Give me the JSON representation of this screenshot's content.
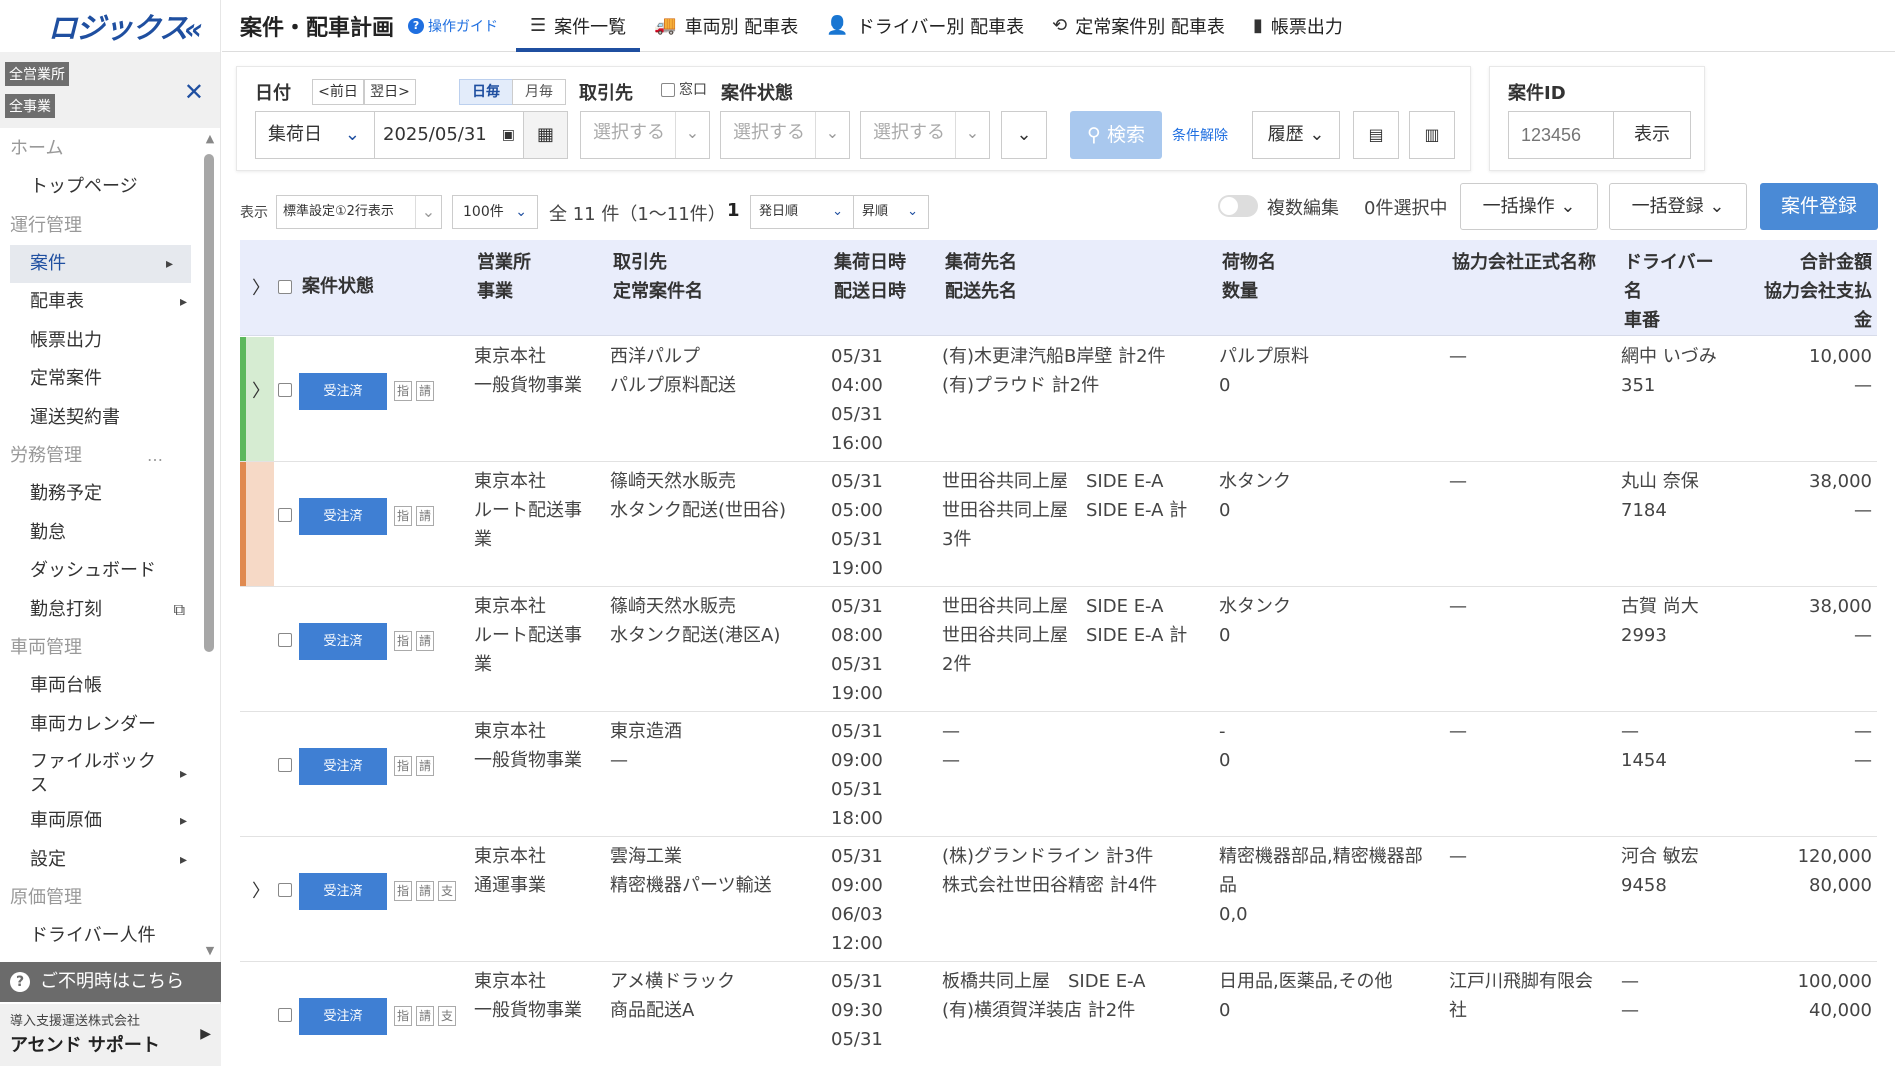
{
  "brand": {
    "logo": "ロジックス"
  },
  "scope": {
    "tag1": "全営業所",
    "tag2": "全事業"
  },
  "nav": {
    "home": "ホーム",
    "top_page": "トップページ",
    "ops": "運行管理",
    "cases": "案件",
    "dispatch": "配車表",
    "forms": "帳票出力",
    "regular": "定常案件",
    "contracts": "運送契約書",
    "labor": "労務管理",
    "labor_more": "…",
    "shift": "勤務予定",
    "attendance": "勤怠",
    "dashboard": "ダッシュボード",
    "clock": "勤怠打刻",
    "vehicle": "車両管理",
    "ledger": "車両台帳",
    "calendar": "車両カレンダー",
    "filebox": "ファイルボックス",
    "vcost": "車両原価",
    "settings": "設定",
    "cost": "原価管理",
    "driver_cost": "ドライバー人件"
  },
  "help": {
    "label": "ご不明時はこちら"
  },
  "company": {
    "sub": "導入支援運送株式会社",
    "name": "アセンド サポート"
  },
  "header": {
    "title": "案件・配車計画",
    "guide": "操作ガイド",
    "tabs": [
      "案件一覧",
      "車両別 配車表",
      "ドライバー別 配車表",
      "定常案件別 配車表",
      "帳票出力"
    ]
  },
  "filter": {
    "date_label": "日付",
    "prev": "<前日",
    "next": "翌日>",
    "daily": "日毎",
    "monthly": "月毎",
    "client_label": "取引先",
    "window_label": "窓口",
    "status_label": "案件状態",
    "date_type": "集荷日",
    "date_value": "2025/05/31",
    "select_ph": "選択する",
    "search": "検索",
    "clear": "条件解除",
    "history": "履歴"
  },
  "idsearch": {
    "label": "案件ID",
    "placeholder": "123456",
    "show": "表示"
  },
  "toolbar": {
    "display_label": "表示",
    "display_value": "標準設定①2行表示",
    "per_page": "100件",
    "count": "全 11 件（1〜11件）",
    "page": "1",
    "sort_field": "発日順",
    "sort_dir": "昇順",
    "multi_edit": "複数編集",
    "selected": "0件選択中",
    "bulk_ops": "一括操作",
    "bulk_reg": "一括登録",
    "new_case": "案件登録"
  },
  "columns": {
    "status": "案件状態",
    "office": "営業所",
    "business": "事業",
    "client": "取引先",
    "regular_name": "定常案件名",
    "pickup_dt": "集荷日時",
    "delivery_dt": "配送日時",
    "pickup_to": "集荷先名",
    "delivery_to": "配送先名",
    "cargo": "荷物名",
    "qty": "数量",
    "partner": "協力会社正式名称",
    "driver_l1": "ドライバー",
    "driver_l2": "名",
    "car_no": "車番",
    "total_l1": "合計金額",
    "total_l2": "協力会社支払",
    "total_l3": "金"
  },
  "rows": [
    {
      "status": "受注済",
      "office": "東京本社",
      "business1": "一般貨物事業",
      "business2": "",
      "client": "西洋パルプ",
      "rname1": "パルプ原料配送",
      "rname2": "",
      "d1": "05/31",
      "d2": "04:00",
      "d3": "05/31",
      "d4": "16:00",
      "p1": "(有)木更津汽船B岸壁 計2件",
      "p2": "(有)プラウド 計2件",
      "p3": "",
      "cargo1": "パルプ原料",
      "cargo2": "0",
      "cargo3": "",
      "partner1": "—",
      "partner2": "",
      "driver": "網中 いづみ",
      "car": "351",
      "amt": "10,000",
      "pay": "—",
      "m1": "指",
      "m2": "請",
      "m3": "",
      "bar": "#5cb85c",
      "fill": "#d6ecd2",
      "chev": "〉"
    },
    {
      "status": "受注済",
      "office": "東京本社",
      "business1": "ルート配送事",
      "business2": "業",
      "client": "篠崎天然水販売",
      "rname1": "水タンク配送(世田谷)",
      "rname2": "",
      "d1": "05/31",
      "d2": "05:00",
      "d3": "05/31",
      "d4": "19:00",
      "p1": "世田谷共同上屋　SIDE E-A",
      "p2": "世田谷共同上屋　SIDE E-A 計",
      "p3": "3件",
      "cargo1": "水タンク",
      "cargo2": "0",
      "cargo3": "",
      "partner1": "—",
      "partner2": "",
      "driver": "丸山 奈保",
      "car": "7184",
      "amt": "38,000",
      "pay": "—",
      "m1": "指",
      "m2": "請",
      "m3": "",
      "bar": "#e08a50",
      "fill": "#f6d9c6",
      "chev": ""
    },
    {
      "status": "受注済",
      "office": "東京本社",
      "business1": "ルート配送事",
      "business2": "業",
      "client": "篠崎天然水販売",
      "rname1": "水タンク配送(港区A)",
      "rname2": "",
      "d1": "05/31",
      "d2": "08:00",
      "d3": "05/31",
      "d4": "19:00",
      "p1": "世田谷共同上屋　SIDE E-A",
      "p2": "世田谷共同上屋　SIDE E-A 計",
      "p3": "2件",
      "cargo1": "水タンク",
      "cargo2": "0",
      "cargo3": "",
      "partner1": "—",
      "partner2": "",
      "driver": "古賀 尚大",
      "car": "2993",
      "amt": "38,000",
      "pay": "—",
      "m1": "指",
      "m2": "請",
      "m3": "",
      "bar": "#ffffff",
      "fill": "#ffffff",
      "chev": ""
    },
    {
      "status": "受注済",
      "office": "東京本社",
      "business1": "一般貨物事業",
      "business2": "",
      "client": "東京造酒",
      "rname1": "—",
      "rname2": "",
      "d1": "05/31",
      "d2": "09:00",
      "d3": "05/31",
      "d4": "18:00",
      "p1": "—",
      "p2": "—",
      "p3": "",
      "cargo1": "-",
      "cargo2": "0",
      "cargo3": "",
      "partner1": "—",
      "partner2": "",
      "driver": "—",
      "car": "1454",
      "amt": "—",
      "pay": "—",
      "m1": "指",
      "m2": "請",
      "m3": "",
      "bar": "#ffffff",
      "fill": "#ffffff",
      "chev": ""
    },
    {
      "status": "受注済",
      "office": "東京本社",
      "business1": "通運事業",
      "business2": "",
      "client": "雲海工業",
      "rname1": "精密機器パーツ輸送",
      "rname2": "",
      "d1": "05/31",
      "d2": "09:00",
      "d3": "06/03",
      "d4": "12:00",
      "p1": "(株)グランドライン 計3件",
      "p2": "株式会社世田谷精密 計4件",
      "p3": "",
      "cargo1": "精密機器部品,精密機器部",
      "cargo2": "品",
      "cargo3": "0,0",
      "partner1": "—",
      "partner2": "",
      "driver": "河合 敏宏",
      "car": "9458",
      "amt": "120,000",
      "pay": "80,000",
      "m1": "指",
      "m2": "請",
      "m3": "支",
      "bar": "#ffffff",
      "fill": "#ffffff",
      "chev": "〉"
    },
    {
      "status": "受注済",
      "office": "東京本社",
      "business1": "一般貨物事業",
      "business2": "",
      "client": "アメ横ドラック",
      "rname1": "商品配送A",
      "rname2": "",
      "d1": "05/31",
      "d2": "09:30",
      "d3": "05/31",
      "d4": "",
      "p1": "板橋共同上屋　SIDE E-A",
      "p2": "(有)横須賀洋装店 計2件",
      "p3": "",
      "cargo1": "日用品,医薬品,その他",
      "cargo2": "0",
      "cargo3": "",
      "partner1": "江戸川飛脚有限会",
      "partner2": "社",
      "driver": "—",
      "car": "—",
      "amt": "100,000",
      "pay": "40,000",
      "m1": "指",
      "m2": "請",
      "m3": "支",
      "bar": "#ffffff",
      "fill": "#ffffff",
      "chev": ""
    }
  ]
}
